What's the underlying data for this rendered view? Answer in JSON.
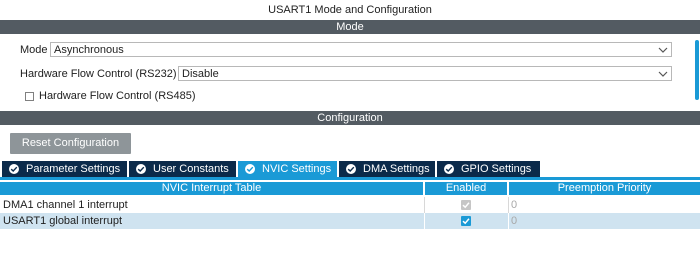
{
  "window": {
    "title": "USART1 Mode and Configuration"
  },
  "mode_section": {
    "header": "Mode",
    "mode_label": "Mode",
    "mode_value": "Asynchronous",
    "flow_control_rs232_label": "Hardware Flow Control (RS232)",
    "flow_control_rs232_value": "Disable",
    "flow_control_rs485_label": "Hardware Flow Control (RS485)",
    "flow_control_rs485_checked": false
  },
  "configuration_section": {
    "header": "Configuration",
    "reset_button": "Reset Configuration",
    "tabs": [
      {
        "label": "Parameter Settings",
        "active": false
      },
      {
        "label": "User Constants",
        "active": false
      },
      {
        "label": "NVIC Settings",
        "active": true
      },
      {
        "label": "DMA Settings",
        "active": false
      },
      {
        "label": "GPIO Settings",
        "active": false
      }
    ],
    "nvic_table": {
      "columns": [
        "NVIC Interrupt Table",
        "Enabled",
        "Preemption Priority"
      ],
      "rows": [
        {
          "name": "DMA1 channel 1 interrupt",
          "enabled": true,
          "enabled_editable": false,
          "priority": "0"
        },
        {
          "name": "USART1 global interrupt",
          "enabled": true,
          "enabled_editable": true,
          "priority": "0"
        }
      ]
    }
  },
  "colors": {
    "accent": "#1a9ad6",
    "header_bg": "#535b62",
    "tab_bg": "#0b2a4a",
    "button_bg": "#8e9599",
    "selected_row": "#cfe3f0"
  },
  "icons": {
    "select_chevron": "chevron-down-icon",
    "tab_status": "check-circle-icon"
  }
}
